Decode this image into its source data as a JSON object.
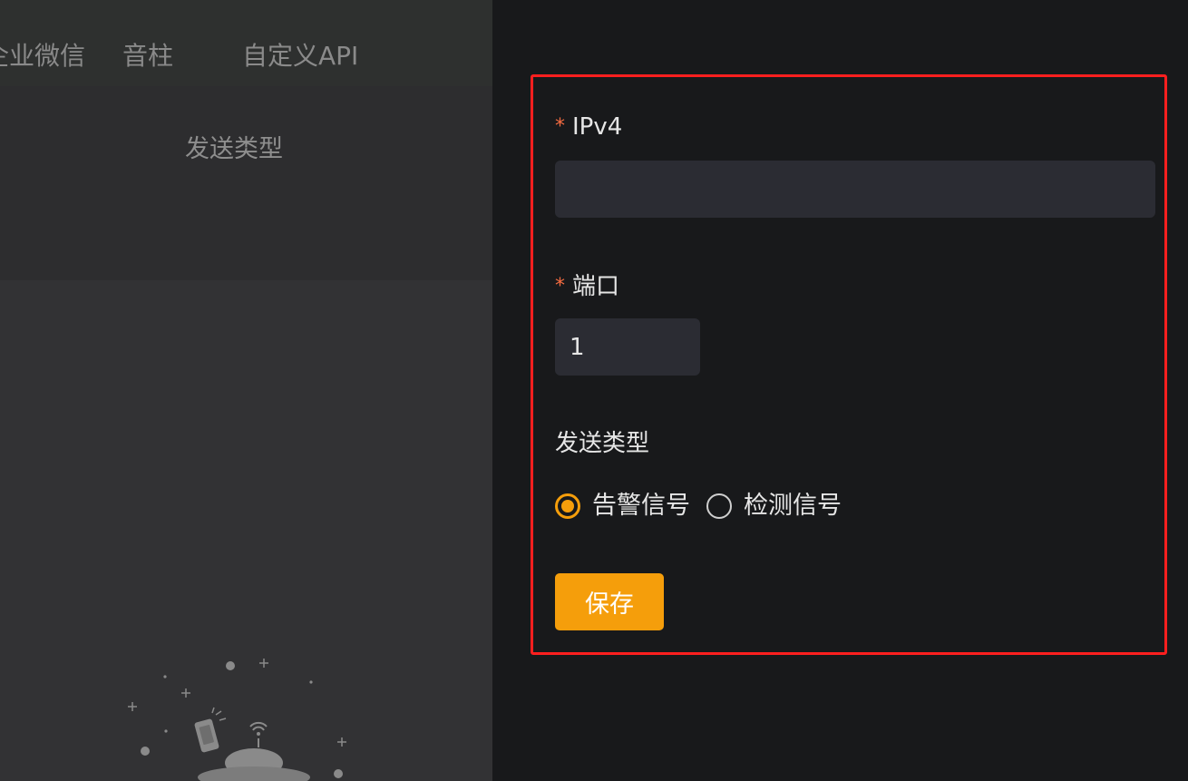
{
  "background_tabs": {
    "tab_wechat": "企业微信",
    "tab_soundpost": "音柱",
    "tab_customapi": "自定义API"
  },
  "background_table": {
    "column_header": "发送类型"
  },
  "form": {
    "ipv4": {
      "label": "IPv4",
      "required_mark": "*",
      "value": ""
    },
    "port": {
      "label": "端口",
      "required_mark": "*",
      "value": "1"
    },
    "send_type": {
      "label": "发送类型",
      "options": [
        {
          "label": "告警信号",
          "checked": true
        },
        {
          "label": "检测信号",
          "checked": false
        }
      ]
    },
    "save_label": "保存"
  },
  "colors": {
    "accent": "#f59e0b",
    "highlight_frame": "#ff1f1f",
    "required_star": "#f56c41"
  },
  "icons": {
    "empty_state": "empty-box-illustration",
    "radio_checked": "radio-checked-icon",
    "radio_unchecked": "radio-unchecked-icon"
  }
}
